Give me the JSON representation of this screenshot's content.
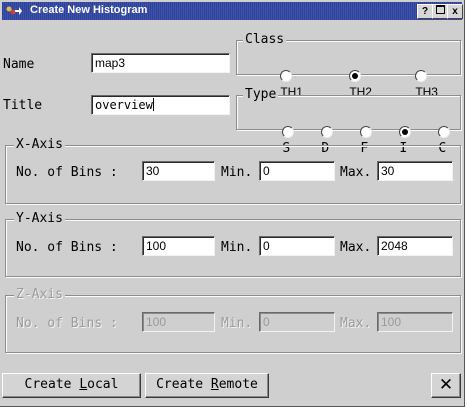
{
  "window": {
    "title": "Create New Histogram",
    "buttons": {
      "help": "?",
      "maximize": "□",
      "close": "x"
    }
  },
  "name": {
    "label": "Name",
    "value": "map3"
  },
  "title_field": {
    "label": "Title",
    "value": "overview"
  },
  "class_group": {
    "legend": "Class",
    "options": [
      {
        "label": "TH1",
        "selected": false
      },
      {
        "label": "TH2",
        "selected": true
      },
      {
        "label": "TH3",
        "selected": false
      }
    ]
  },
  "type_group": {
    "legend": "Type",
    "options": [
      {
        "label": "S",
        "selected": false
      },
      {
        "label": "D",
        "selected": false
      },
      {
        "label": "F",
        "selected": false
      },
      {
        "label": "I",
        "selected": true
      },
      {
        "label": "C",
        "selected": false
      }
    ]
  },
  "x_axis": {
    "legend": "X-Axis",
    "bins_label": "No. of Bins :",
    "bins": "30",
    "min_label": "Min.",
    "min": "0",
    "max_label": "Max.",
    "max": "30"
  },
  "y_axis": {
    "legend": "Y-Axis",
    "bins_label": "No. of Bins :",
    "bins": "100",
    "min_label": "Min.",
    "min": "0",
    "max_label": "Max.",
    "max": "2048"
  },
  "z_axis": {
    "legend": "Z-Axis",
    "bins_label": "No. of Bins :",
    "bins": "100",
    "min_label": "Min.",
    "min": "0",
    "max_label": "Max.",
    "max": "100",
    "disabled": true
  },
  "actions": {
    "create_local_prefix": "Create ",
    "create_local_key": "L",
    "create_local_rest": "ocal",
    "create_remote_prefix": "Create ",
    "create_remote_key": "R",
    "create_remote_rest": "emote",
    "close_glyph": "✕"
  }
}
